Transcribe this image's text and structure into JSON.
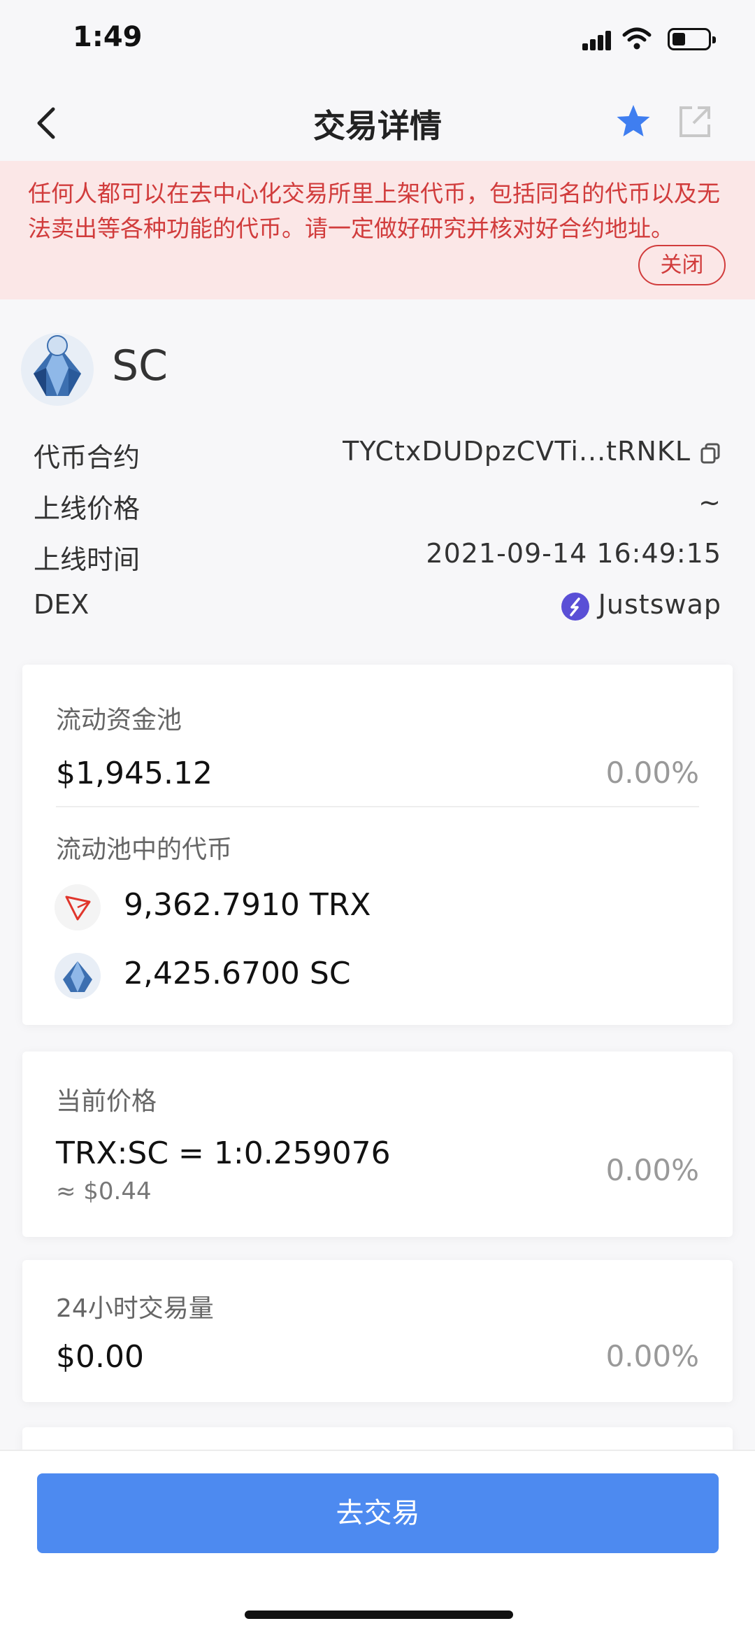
{
  "status": {
    "time": "1:49"
  },
  "nav": {
    "title": "交易详情"
  },
  "warning": {
    "text": "任何人都可以在去中心化交易所里上架代币，包括同名的代币以及无法卖出等各种功能的代币。请一定做好研究并核对好合约地址。",
    "close_label": "关闭"
  },
  "token": {
    "symbol": "SC",
    "rows": [
      {
        "label": "代币合约",
        "value": "TYCtxDUDpzCVTi...tRNKL"
      },
      {
        "label": "上线价格",
        "value": "~"
      },
      {
        "label": "上线时间",
        "value": "2021-09-14 16:49:15"
      },
      {
        "label": "DEX",
        "value": "Justswap"
      }
    ]
  },
  "liquidity": {
    "label": "流动资金池",
    "value": "$1,945.12",
    "change": "0.00%",
    "pool_label": "流动池中的代币",
    "pool_tokens": [
      {
        "amount": "9,362.7910 TRX",
        "icon": "trx-logo-icon"
      },
      {
        "amount": "2,425.6700 SC",
        "icon": "sc-logo-icon"
      }
    ]
  },
  "price": {
    "label": "当前价格",
    "value": "TRX:SC = 1:0.259076",
    "usd": "≈ $0.44",
    "change": "0.00%"
  },
  "volume": {
    "label": "24小时交易量",
    "value": "$0.00",
    "change": "0.00%"
  },
  "action": {
    "trade_label": "去交易"
  },
  "colors": {
    "accent": "#4d8af0",
    "warning_text": "#d13c3c",
    "warning_bg": "#fbe7e7",
    "trx_red": "#e0362c"
  }
}
